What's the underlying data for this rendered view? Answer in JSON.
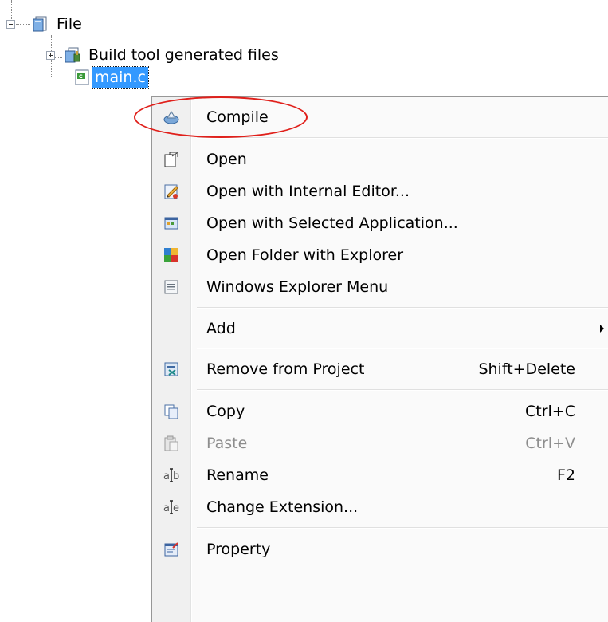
{
  "tree": {
    "root": {
      "label": "File",
      "icon": "folder-icon"
    },
    "children": [
      {
        "label": "Build tool generated files",
        "icon": "build-files-folder-icon"
      },
      {
        "label": "main.c",
        "icon": "c-source-file-icon",
        "selected": true
      }
    ]
  },
  "context_menu": {
    "items": [
      {
        "label": "Compile",
        "shortcut": "",
        "icon": "compile-icon"
      },
      {
        "label": "Open",
        "shortcut": "",
        "icon": "open-icon"
      },
      {
        "label": "Open with Internal Editor...",
        "shortcut": "",
        "icon": "internal-editor-icon"
      },
      {
        "label": "Open with Selected Application...",
        "shortcut": "",
        "icon": "selected-application-icon"
      },
      {
        "label": "Open Folder with Explorer",
        "shortcut": "",
        "icon": "explorer-folder-icon"
      },
      {
        "label": "Windows Explorer Menu",
        "shortcut": "",
        "icon": "explorer-menu-icon"
      },
      {
        "label": "Add",
        "shortcut": "",
        "icon": "",
        "submenu": true
      },
      {
        "label": "Remove from Project",
        "shortcut": "Shift+Delete",
        "icon": "remove-icon"
      },
      {
        "label": "Copy",
        "shortcut": "Ctrl+C",
        "icon": "copy-icon"
      },
      {
        "label": "Paste",
        "shortcut": "Ctrl+V",
        "icon": "paste-icon",
        "disabled": true
      },
      {
        "label": "Rename",
        "shortcut": "F2",
        "icon": "rename-icon"
      },
      {
        "label": "Change Extension...",
        "shortcut": "",
        "icon": "change-extension-icon"
      },
      {
        "label": "Property",
        "shortcut": "",
        "icon": "property-icon"
      }
    ]
  },
  "colors": {
    "selection": "#3399ff",
    "highlight_ellipse": "#e0201b",
    "disabled_text": "#8d8d8d"
  }
}
